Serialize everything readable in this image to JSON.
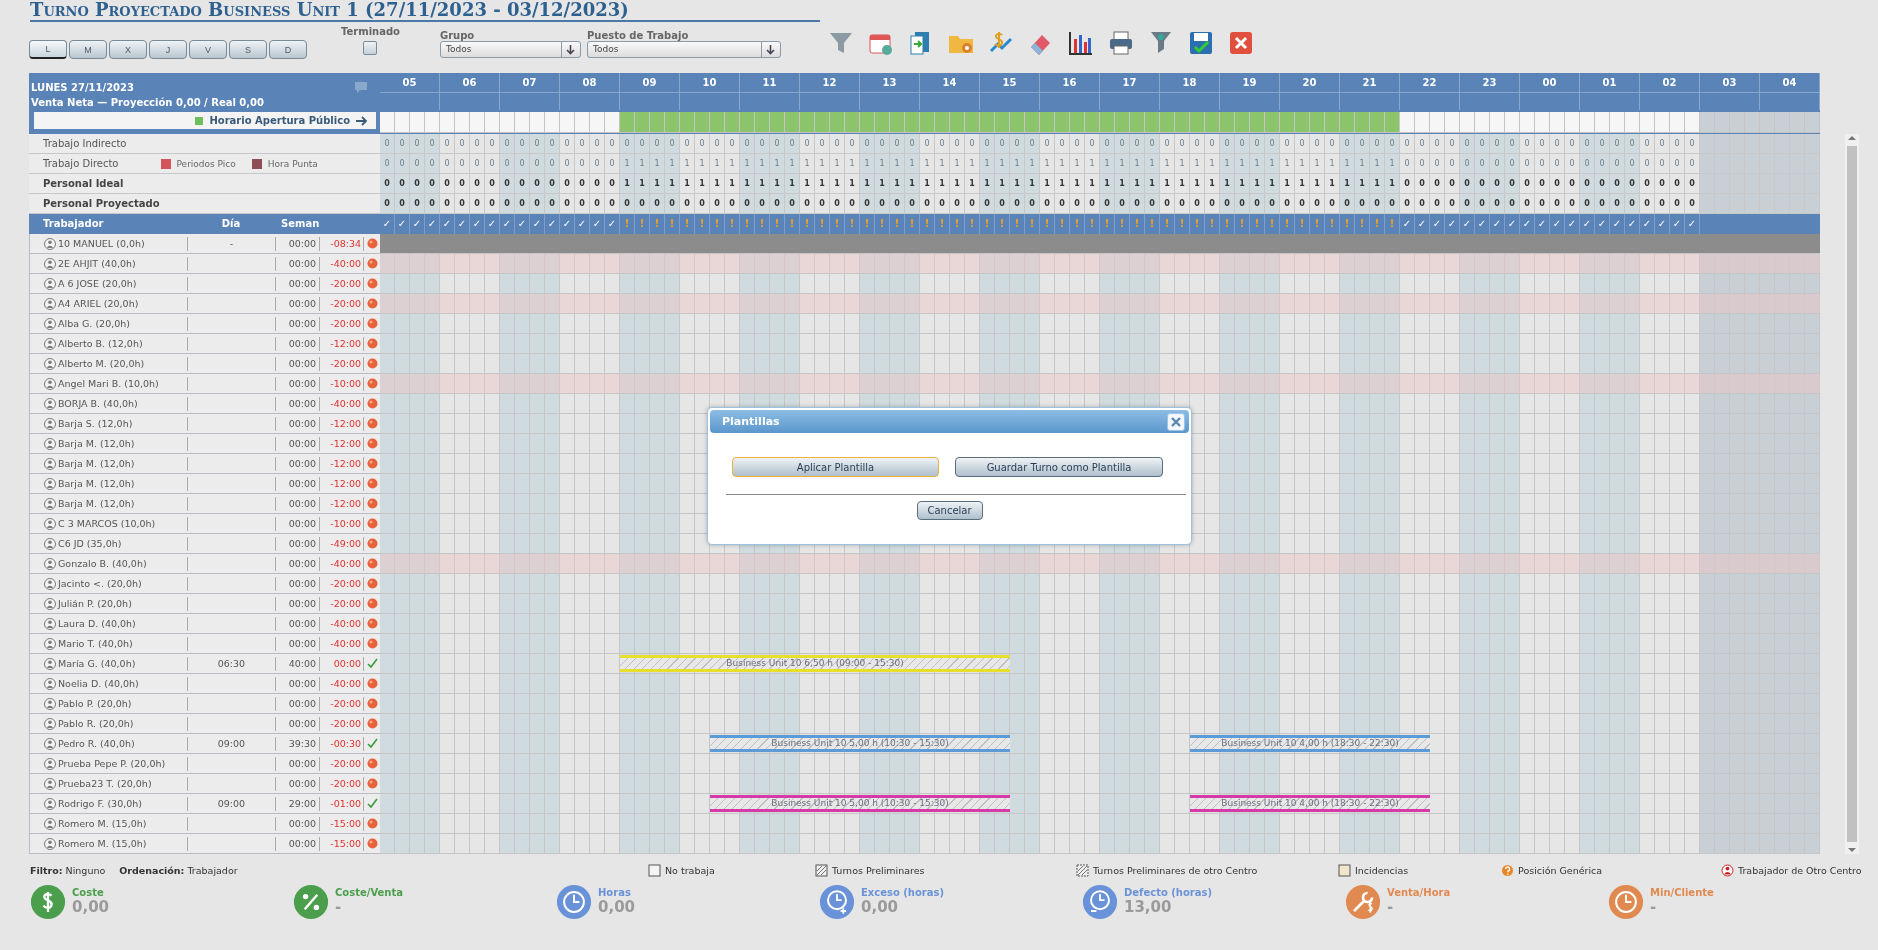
{
  "title": "Turno Proyectado Business Unit 1 (27/11/2023 - 03/12/2023)",
  "days": [
    {
      "label": "L",
      "selected": true
    },
    {
      "label": "M",
      "selected": false
    },
    {
      "label": "X",
      "selected": false
    },
    {
      "label": "J",
      "selected": false
    },
    {
      "label": "V",
      "selected": false
    },
    {
      "label": "S",
      "selected": false
    },
    {
      "label": "D",
      "selected": false
    }
  ],
  "finished": {
    "label": "Terminado",
    "checked": false
  },
  "filters": [
    {
      "label": "Grupo",
      "value": "Todos"
    },
    {
      "label": "Puesto de Trabajo",
      "value": "Todos"
    }
  ],
  "schedule": {
    "date": "LUNES 27/11/2023",
    "sales": "Venta Neta — Proyección 0,00 / Real 0,00",
    "opening_legend": "Horario Apertura Público",
    "hours": [
      {
        "label": "05",
        "open": false,
        "active": true,
        "ok": true,
        "marks": [
          "✓",
          "✓",
          "✓",
          "✓"
        ]
      },
      {
        "label": "06",
        "open": false,
        "active": true,
        "ok": true,
        "marks": [
          "✓",
          "✓",
          "✓",
          "✓"
        ]
      },
      {
        "label": "07",
        "open": false,
        "active": true,
        "ok": true,
        "marks": [
          "✓",
          "✓",
          "✓",
          "✓"
        ]
      },
      {
        "label": "08",
        "open": false,
        "active": true,
        "ok": true,
        "marks": [
          "✓",
          "✓",
          "✓",
          "✓"
        ]
      },
      {
        "label": "09",
        "open": true,
        "active": true,
        "ok": false,
        "marks": [
          "!",
          "!",
          "!",
          "!"
        ]
      },
      {
        "label": "10",
        "open": true,
        "active": true,
        "ok": false,
        "marks": [
          "!",
          "!",
          "!",
          "!"
        ]
      },
      {
        "label": "11",
        "open": true,
        "active": true,
        "ok": false,
        "marks": [
          "!",
          "!",
          "!",
          "!"
        ]
      },
      {
        "label": "12",
        "open": true,
        "active": true,
        "ok": false,
        "marks": [
          "!",
          "!",
          "!",
          "!"
        ]
      },
      {
        "label": "13",
        "open": true,
        "active": true,
        "ok": false,
        "marks": [
          "!",
          "!",
          "!",
          "!"
        ]
      },
      {
        "label": "14",
        "open": true,
        "active": true,
        "ok": false,
        "marks": [
          "!",
          "!",
          "!",
          "!"
        ]
      },
      {
        "label": "15",
        "open": true,
        "active": true,
        "ok": false,
        "marks": [
          "!",
          "!",
          "!",
          "!"
        ]
      },
      {
        "label": "16",
        "open": true,
        "active": true,
        "ok": false,
        "marks": [
          "!",
          "!",
          "!",
          "!"
        ]
      },
      {
        "label": "17",
        "open": true,
        "active": true,
        "ok": false,
        "marks": [
          "!",
          "!",
          "!",
          "!"
        ]
      },
      {
        "label": "18",
        "open": true,
        "active": true,
        "ok": false,
        "marks": [
          "!",
          "!",
          "!",
          "!"
        ]
      },
      {
        "label": "19",
        "open": true,
        "active": true,
        "ok": false,
        "marks": [
          "!",
          "!",
          "!",
          "!"
        ]
      },
      {
        "label": "20",
        "open": true,
        "active": true,
        "ok": false,
        "marks": [
          "!",
          "!",
          "!",
          "!"
        ]
      },
      {
        "label": "21",
        "open": true,
        "active": true,
        "ok": false,
        "marks": [
          "!",
          "!",
          "!",
          "!"
        ]
      },
      {
        "label": "22",
        "open": false,
        "active": true,
        "ok": true,
        "marks": [
          "✓",
          "✓",
          "✓",
          "✓"
        ]
      },
      {
        "label": "23",
        "open": false,
        "active": true,
        "ok": true,
        "marks": [
          "✓",
          "✓",
          "✓",
          "✓"
        ]
      },
      {
        "label": "00",
        "open": false,
        "active": true,
        "ok": true,
        "marks": [
          "✓",
          "✓",
          "✓",
          "✓"
        ]
      },
      {
        "label": "01",
        "open": false,
        "active": true,
        "ok": true,
        "marks": [
          "✓",
          "✓",
          "✓",
          "✓"
        ]
      },
      {
        "label": "02",
        "open": false,
        "active": true,
        "ok": true,
        "marks": [
          "✓",
          "✓",
          "✓",
          "✓"
        ]
      },
      {
        "label": "03",
        "open": false,
        "active": false
      },
      {
        "label": "04",
        "open": false,
        "active": false
      }
    ],
    "rows": [
      {
        "label": "Trabajo Indirecto",
        "bold": false,
        "values": [
          "0",
          "0",
          "0",
          "0",
          "0",
          "0",
          "0",
          "0",
          "0",
          "0",
          "0",
          "0",
          "0",
          "0",
          "0",
          "0",
          "0",
          "0",
          "0",
          "0",
          "0",
          "0",
          "0",
          "0",
          "0",
          "0",
          "0",
          "0",
          "0",
          "0",
          "0",
          "0",
          "0",
          "0",
          "0",
          "0",
          "0",
          "0",
          "0",
          "0",
          "0",
          "0",
          "0",
          "0",
          "0",
          "0",
          "0",
          "0",
          "0",
          "0",
          "0",
          "0",
          "0",
          "0",
          "0",
          "0",
          "0",
          "0",
          "0",
          "0",
          "0",
          "0",
          "0",
          "0",
          "0",
          "0",
          "0",
          "0",
          "0",
          "0",
          "0",
          "0",
          "0",
          "0",
          "0",
          "0",
          "0",
          "0",
          "0",
          "0",
          "0",
          "0",
          "0",
          "0",
          "0",
          "0",
          "0",
          "0"
        ]
      },
      {
        "label": "Trabajo Directo",
        "bold": false,
        "legend": [
          {
            "label": "Periodos Pico",
            "color": "#d4545c"
          },
          {
            "label": "Hora Punta",
            "color": "#8c4d55"
          }
        ],
        "values": [
          "0",
          "0",
          "0",
          "0",
          "0",
          "0",
          "0",
          "0",
          "0",
          "0",
          "0",
          "0",
          "0",
          "0",
          "0",
          "0",
          "1",
          "1",
          "1",
          "1",
          "1",
          "1",
          "1",
          "1",
          "1",
          "1",
          "1",
          "1",
          "1",
          "1",
          "1",
          "1",
          "1",
          "1",
          "1",
          "1",
          "1",
          "1",
          "1",
          "1",
          "1",
          "1",
          "1",
          "1",
          "1",
          "1",
          "1",
          "1",
          "1",
          "1",
          "1",
          "1",
          "1",
          "1",
          "1",
          "1",
          "1",
          "1",
          "1",
          "1",
          "1",
          "1",
          "1",
          "1",
          "1",
          "1",
          "1",
          "1",
          "0",
          "0",
          "0",
          "0",
          "0",
          "0",
          "0",
          "0",
          "0",
          "0",
          "0",
          "0",
          "0",
          "0",
          "0",
          "0",
          "0",
          "0",
          "0",
          "0"
        ]
      },
      {
        "label": "Personal Ideal",
        "bold": true,
        "values": [
          "0",
          "0",
          "0",
          "0",
          "0",
          "0",
          "0",
          "0",
          "0",
          "0",
          "0",
          "0",
          "0",
          "0",
          "0",
          "0",
          "1",
          "1",
          "1",
          "1",
          "1",
          "1",
          "1",
          "1",
          "1",
          "1",
          "1",
          "1",
          "1",
          "1",
          "1",
          "1",
          "1",
          "1",
          "1",
          "1",
          "1",
          "1",
          "1",
          "1",
          "1",
          "1",
          "1",
          "1",
          "1",
          "1",
          "1",
          "1",
          "1",
          "1",
          "1",
          "1",
          "1",
          "1",
          "1",
          "1",
          "1",
          "1",
          "1",
          "1",
          "1",
          "1",
          "1",
          "1",
          "1",
          "1",
          "1",
          "1",
          "0",
          "0",
          "0",
          "0",
          "0",
          "0",
          "0",
          "0",
          "0",
          "0",
          "0",
          "0",
          "0",
          "0",
          "0",
          "0",
          "0",
          "0",
          "0",
          "0"
        ]
      },
      {
        "label": "Personal Proyectado",
        "bold": true,
        "values": [
          "0",
          "0",
          "0",
          "0",
          "0",
          "0",
          "0",
          "0",
          "0",
          "0",
          "0",
          "0",
          "0",
          "0",
          "0",
          "0",
          "0",
          "0",
          "0",
          "0",
          "0",
          "0",
          "0",
          "0",
          "0",
          "0",
          "0",
          "0",
          "0",
          "0",
          "0",
          "0",
          "0",
          "0",
          "0",
          "0",
          "0",
          "0",
          "0",
          "0",
          "0",
          "0",
          "0",
          "0",
          "0",
          "0",
          "0",
          "0",
          "0",
          "0",
          "0",
          "0",
          "0",
          "0",
          "0",
          "0",
          "0",
          "0",
          "0",
          "0",
          "0",
          "0",
          "0",
          "0",
          "0",
          "0",
          "0",
          "0",
          "0",
          "0",
          "0",
          "0",
          "0",
          "0",
          "0",
          "0",
          "0",
          "0",
          "0",
          "0",
          "0",
          "0",
          "0",
          "0",
          "0",
          "0",
          "0",
          "0"
        ]
      }
    ],
    "worker_columns": [
      "Trabajador",
      "Día",
      "Seman"
    ],
    "workers": [
      {
        "name": "10 MANUEL (0,0h)",
        "day": "-",
        "week": "00:00",
        "balance": "-08:34",
        "ok": false,
        "kind": "inactive"
      },
      {
        "name": "2E AHJIT (40,0h)",
        "week": "00:00",
        "balance": "-40:00",
        "ok": false,
        "kind": "highlighted"
      },
      {
        "name": "A 6 JOSE (20,0h)",
        "week": "00:00",
        "balance": "-20:00",
        "ok": false,
        "kind": "normal"
      },
      {
        "name": "A4 ARIEL (20,0h)",
        "week": "00:00",
        "balance": "-20:00",
        "ok": false,
        "kind": "highlighted"
      },
      {
        "name": "Alba G. (20,0h)",
        "week": "00:00",
        "balance": "-20:00",
        "ok": false,
        "kind": "normal"
      },
      {
        "name": "Alberto B. (12,0h)",
        "week": "00:00",
        "balance": "-12:00",
        "ok": false,
        "kind": "normal"
      },
      {
        "name": "Alberto M. (20,0h)",
        "week": "00:00",
        "balance": "-20:00",
        "ok": false,
        "kind": "normal"
      },
      {
        "name": "Angel Mari B. (10,0h)",
        "week": "00:00",
        "balance": "-10:00",
        "ok": false,
        "kind": "highlighted"
      },
      {
        "name": "BORJA B. (40,0h)",
        "week": "00:00",
        "balance": "-40:00",
        "ok": false,
        "kind": "normal"
      },
      {
        "name": "Barja S. (12,0h)",
        "week": "00:00",
        "balance": "-12:00",
        "ok": false,
        "kind": "normal"
      },
      {
        "name": "Barja M. (12,0h)",
        "week": "00:00",
        "balance": "-12:00",
        "ok": false,
        "kind": "normal"
      },
      {
        "name": "Barja M. (12,0h)",
        "week": "00:00",
        "balance": "-12:00",
        "ok": false,
        "kind": "normal"
      },
      {
        "name": "Barja M. (12,0h)",
        "week": "00:00",
        "balance": "-12:00",
        "ok": false,
        "kind": "normal"
      },
      {
        "name": "Barja M. (12,0h)",
        "week": "00:00",
        "balance": "-12:00",
        "ok": false,
        "kind": "normal"
      },
      {
        "name": "C 3 MARCOS (10,0h)",
        "week": "00:00",
        "balance": "-10:00",
        "ok": false,
        "kind": "normal"
      },
      {
        "name": "C6 JD (35,0h)",
        "week": "00:00",
        "balance": "-49:00",
        "ok": false,
        "kind": "normal"
      },
      {
        "name": "Gonzalo B. (40,0h)",
        "week": "00:00",
        "balance": "-40:00",
        "ok": false,
        "kind": "highlighted"
      },
      {
        "name": "Jacinto <. (20,0h)",
        "week": "00:00",
        "balance": "-20:00",
        "ok": false,
        "kind": "normal"
      },
      {
        "name": "Julián P. (20,0h)",
        "week": "00:00",
        "balance": "-20:00",
        "ok": false,
        "kind": "normal"
      },
      {
        "name": "Laura D. (40,0h)",
        "week": "00:00",
        "balance": "-40:00",
        "ok": false,
        "kind": "normal"
      },
      {
        "name": "Mario T. (40,0h)",
        "week": "00:00",
        "balance": "-40:00",
        "ok": false,
        "kind": "normal"
      },
      {
        "name": "María G. (40,0h)",
        "day": "06:30",
        "week": "40:00",
        "balance": "00:00",
        "ok": true,
        "kind": "normal",
        "shifts": [
          {
            "label": "Business Unit 10 6,50 h (09:00 - 15:30)",
            "color": "#e6df2c"
          }
        ]
      },
      {
        "name": "Noelia D. (40,0h)",
        "week": "00:00",
        "balance": "-40:00",
        "ok": false,
        "kind": "normal"
      },
      {
        "name": "Pablo P. (20,0h)",
        "week": "00:00",
        "balance": "-20:00",
        "ok": false,
        "kind": "normal"
      },
      {
        "name": "Pablo R. (20,0h)",
        "week": "00:00",
        "balance": "-20:00",
        "ok": false,
        "kind": "normal"
      },
      {
        "name": "Pedro R. (40,0h)",
        "day": "09:00",
        "week": "39:30",
        "balance": "-00:30",
        "ok": true,
        "kind": "normal",
        "shifts": [
          {
            "label": "Business Unit 10 5,00 h (10:30 - 15:30)",
            "color": "#5b9bd8"
          },
          {
            "label": "Business Unit 10 4,00 h (18:30 - 22:30)",
            "color": "#5b9bd8"
          }
        ]
      },
      {
        "name": "Prueba Pepe P. (20,0h)",
        "week": "00:00",
        "balance": "-20:00",
        "ok": false,
        "kind": "normal"
      },
      {
        "name": "Prueba23 T. (20,0h)",
        "week": "00:00",
        "balance": "-20:00",
        "ok": false,
        "kind": "normal"
      },
      {
        "name": "Rodrigo F. (30,0h)",
        "day": "09:00",
        "week": "29:00",
        "balance": "-01:00",
        "ok": true,
        "kind": "normal",
        "shifts": [
          {
            "label": "Business Unit 10 5,00 h (10:30 - 15:30)",
            "color": "#d53aa6"
          },
          {
            "label": "Business Unit 10 4,00 h (18:30 - 22:30)",
            "color": "#d53aa6"
          }
        ]
      },
      {
        "name": "Romero M. (15,0h)",
        "week": "00:00",
        "balance": "-15:00",
        "ok": false,
        "kind": "normal"
      },
      {
        "name": "Romero M. (15,0h)",
        "week": "00:00",
        "balance": "-15:00",
        "ok": false,
        "kind": "normal"
      }
    ]
  },
  "dialog": {
    "title": "Plantillas",
    "buttons": [
      {
        "label": "Aplicar Plantilla",
        "focused": true
      },
      {
        "label": "Guardar Turno como Plantilla",
        "focused": false
      }
    ],
    "cancel": "Cancelar"
  },
  "footer": {
    "filter": {
      "label": "Filtro:",
      "value": "Ninguno"
    },
    "order": {
      "label": "Ordenación:",
      "value": "Trabajador"
    },
    "legend": [
      {
        "kind": "empty",
        "label": "No trabaja"
      },
      {
        "kind": "hatched",
        "label": "Turnos Preliminares"
      },
      {
        "kind": "hatched-dotted",
        "label": "Turnos Preliminares de otro Centro"
      },
      {
        "kind": "incident",
        "label": "Incidencias"
      },
      {
        "kind": "generic",
        "label": "Posición Genérica"
      },
      {
        "kind": "other-center",
        "label": "Trabajador de Otro Centro"
      }
    ],
    "kpis": [
      {
        "kind": "dollar",
        "label": "Coste",
        "value": "0,00",
        "color": "#4a9e4c"
      },
      {
        "kind": "percent",
        "label": "Coste/Venta",
        "value": "-",
        "color": "#4a9e4c"
      },
      {
        "kind": "clock",
        "label": "Horas",
        "value": "0,00",
        "color": "#6a92d8"
      },
      {
        "kind": "clock-plus",
        "label": "Exceso (horas)",
        "value": "0,00",
        "color": "#6a92d8"
      },
      {
        "kind": "clock-minus",
        "label": "Defecto (horas)",
        "value": "13,00",
        "color": "#6a92d8"
      },
      {
        "kind": "wrench-dollar",
        "label": "Venta/Hora",
        "value": "-",
        "color": "#e08a52"
      },
      {
        "kind": "clock",
        "label": "Min/Cliente",
        "value": "-",
        "color": "#e08a52"
      }
    ]
  }
}
